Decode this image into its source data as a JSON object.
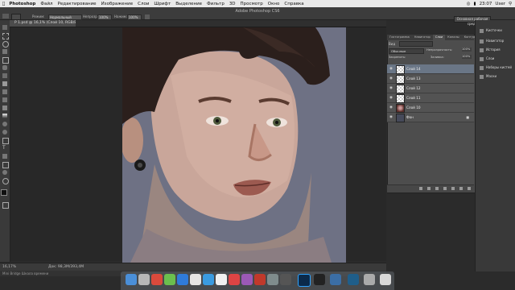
{
  "menubar": {
    "app": "Photoshop",
    "items": [
      "Файл",
      "Редактирование",
      "Изображение",
      "Слои",
      "Шрифт",
      "Выделение",
      "Фильтр",
      "3D",
      "Просмотр",
      "Окно",
      "Справка"
    ],
    "time": "23:07",
    "user": "User"
  },
  "options": {
    "app_title": "Adobe Photoshop CS6",
    "mode_label": "Режим:",
    "mode_value": "Нормальный",
    "opacity_label": "Непрозр.:",
    "opacity_value": "100%",
    "flow_label": "Нажим:",
    "flow_value": "100%",
    "workspace_button": "Основная рабочая среда"
  },
  "document": {
    "tab_title": "Р 1.psd @ 16,1% (Слой 10, RGB/8) *"
  },
  "status": {
    "zoom": "16,17%",
    "doc_info": "Док: 98,3M/393,4M",
    "minibridge": "Mini Bridge  Шкала времени"
  },
  "layers_panel": {
    "tabs": [
      "Гистограмма",
      "Навигатор",
      "Слои",
      "Каналы",
      "Контуры"
    ],
    "active_tab": "Слои",
    "filter_label": "Вид",
    "blend_mode": "Обычные",
    "opacity_label": "Непрозрачность:",
    "opacity_value": "100%",
    "lock_label": "Закрепить:",
    "fill_label": "Заливка:",
    "fill_value": "100%",
    "layers": [
      {
        "name": "Слой 14",
        "thumb": "checker",
        "selected": true
      },
      {
        "name": "Слой 13",
        "thumb": "checker",
        "selected": false
      },
      {
        "name": "Слой 12",
        "thumb": "checker",
        "selected": false
      },
      {
        "name": "Слой 11",
        "thumb": "checker",
        "selected": false
      },
      {
        "name": "Слой 10",
        "thumb": "face",
        "selected": false
      },
      {
        "name": "Фон",
        "thumb": "dark",
        "selected": false
      }
    ]
  },
  "right_dock": {
    "items": [
      "Кисточки",
      "Навигатор",
      "История",
      "Слои",
      "Наборы кистей",
      "Маски"
    ]
  },
  "colors": {
    "accent_selected_layer": "#6a7686",
    "canvas_background": "#6e7184"
  }
}
